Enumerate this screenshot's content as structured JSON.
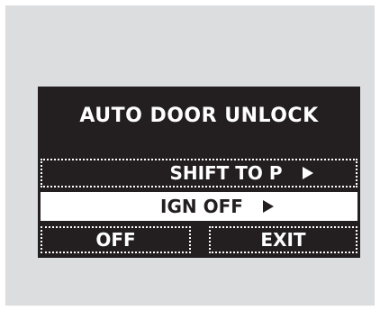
{
  "screen": {
    "title": "AUTO DOOR UNLOCK",
    "items": [
      {
        "label": "SHIFT TO P",
        "icon": "right-arrow-icon",
        "selected": false
      },
      {
        "label": "IGN OFF",
        "icon": "right-arrow-icon",
        "selected": true
      }
    ],
    "buttons": {
      "off": "OFF",
      "exit": "EXIT"
    }
  },
  "colors": {
    "background": "#dcdddf",
    "screen": "#231f20",
    "text": "#ffffff",
    "selected_bg": "#ffffff"
  }
}
